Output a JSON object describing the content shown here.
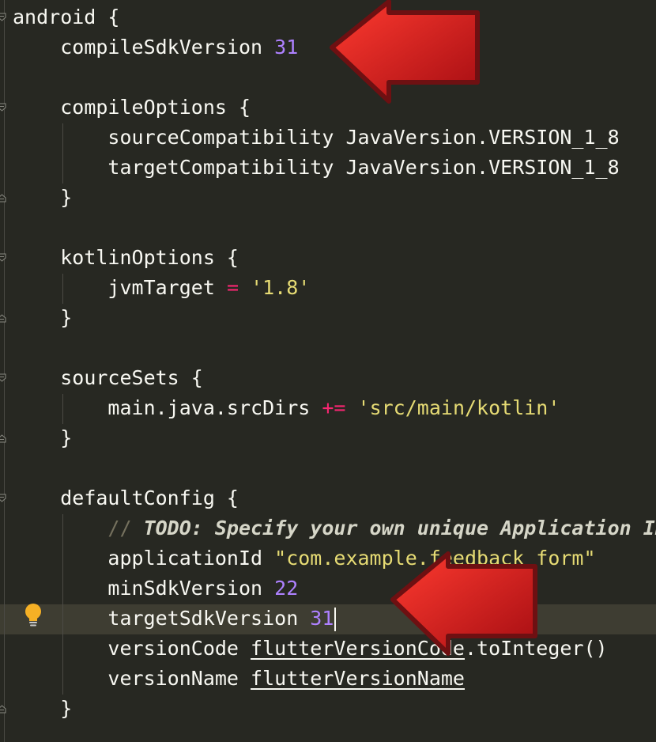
{
  "editor": {
    "lines": [
      {
        "indent": "",
        "tokens": [
          {
            "t": "android {",
            "c": "plain"
          }
        ]
      },
      {
        "indent": "    ",
        "tokens": [
          {
            "t": "compileSdkVersion ",
            "c": "plain"
          },
          {
            "t": "31",
            "c": "num"
          }
        ]
      },
      {
        "indent": "",
        "tokens": []
      },
      {
        "indent": "    ",
        "tokens": [
          {
            "t": "compileOptions {",
            "c": "plain"
          }
        ]
      },
      {
        "indent": "        ",
        "tokens": [
          {
            "t": "sourceCompatibility JavaVersion.VERSION_1_8",
            "c": "plain"
          }
        ]
      },
      {
        "indent": "        ",
        "tokens": [
          {
            "t": "targetCompatibility JavaVersion.VERSION_1_8",
            "c": "plain"
          }
        ]
      },
      {
        "indent": "    ",
        "tokens": [
          {
            "t": "}",
            "c": "plain"
          }
        ]
      },
      {
        "indent": "",
        "tokens": []
      },
      {
        "indent": "    ",
        "tokens": [
          {
            "t": "kotlinOptions {",
            "c": "plain"
          }
        ]
      },
      {
        "indent": "        ",
        "tokens": [
          {
            "t": "jvmTarget ",
            "c": "plain"
          },
          {
            "t": "=",
            "c": "op"
          },
          {
            "t": " ",
            "c": "plain"
          },
          {
            "t": "'1.8'",
            "c": "str"
          }
        ]
      },
      {
        "indent": "    ",
        "tokens": [
          {
            "t": "}",
            "c": "plain"
          }
        ]
      },
      {
        "indent": "",
        "tokens": []
      },
      {
        "indent": "    ",
        "tokens": [
          {
            "t": "sourceSets {",
            "c": "plain"
          }
        ]
      },
      {
        "indent": "        ",
        "tokens": [
          {
            "t": "main.java.srcDirs ",
            "c": "plain"
          },
          {
            "t": "+=",
            "c": "op"
          },
          {
            "t": " ",
            "c": "plain"
          },
          {
            "t": "'src/main/kotlin'",
            "c": "str"
          }
        ]
      },
      {
        "indent": "    ",
        "tokens": [
          {
            "t": "}",
            "c": "plain"
          }
        ]
      },
      {
        "indent": "",
        "tokens": []
      },
      {
        "indent": "    ",
        "tokens": [
          {
            "t": "defaultConfig {",
            "c": "plain"
          }
        ]
      },
      {
        "indent": "        ",
        "tokens": [
          {
            "t": "// ",
            "c": "comment"
          },
          {
            "t": "TODO: Specify your own unique Application ID",
            "c": "todo"
          }
        ]
      },
      {
        "indent": "        ",
        "tokens": [
          {
            "t": "applicationId ",
            "c": "plain"
          },
          {
            "t": "\"com.example.feedback_form\"",
            "c": "str"
          }
        ]
      },
      {
        "indent": "        ",
        "tokens": [
          {
            "t": "minSdkVersion ",
            "c": "plain"
          },
          {
            "t": "22",
            "c": "num"
          }
        ]
      },
      {
        "indent": "        ",
        "tokens": [
          {
            "t": "targetSdkVersion ",
            "c": "plain"
          },
          {
            "t": "31",
            "c": "num"
          },
          {
            "t": "",
            "c": "caret"
          }
        ]
      },
      {
        "indent": "        ",
        "tokens": [
          {
            "t": "versionCode ",
            "c": "plain"
          },
          {
            "t": "flutterVersionCode",
            "c": "ul"
          },
          {
            "t": ".toInteger()",
            "c": "plain"
          }
        ]
      },
      {
        "indent": "        ",
        "tokens": [
          {
            "t": "versionName ",
            "c": "plain"
          },
          {
            "t": "flutterVersionName",
            "c": "ul"
          }
        ]
      },
      {
        "indent": "    ",
        "tokens": [
          {
            "t": "}",
            "c": "plain"
          }
        ]
      }
    ],
    "current_line_index": 20,
    "intention_icon": "lightbulb-icon",
    "annotation_arrows": [
      "red-arrow-icon",
      "red-arrow-icon"
    ]
  },
  "colors": {
    "background": "#272822",
    "current_line": "#3e3d32",
    "text": "#f8f8f2",
    "number": "#ae81ff",
    "string": "#e6db74",
    "operator": "#f92672",
    "comment": "#75715e",
    "arrow": "#d41d1d",
    "bulb": "#f5b025"
  }
}
